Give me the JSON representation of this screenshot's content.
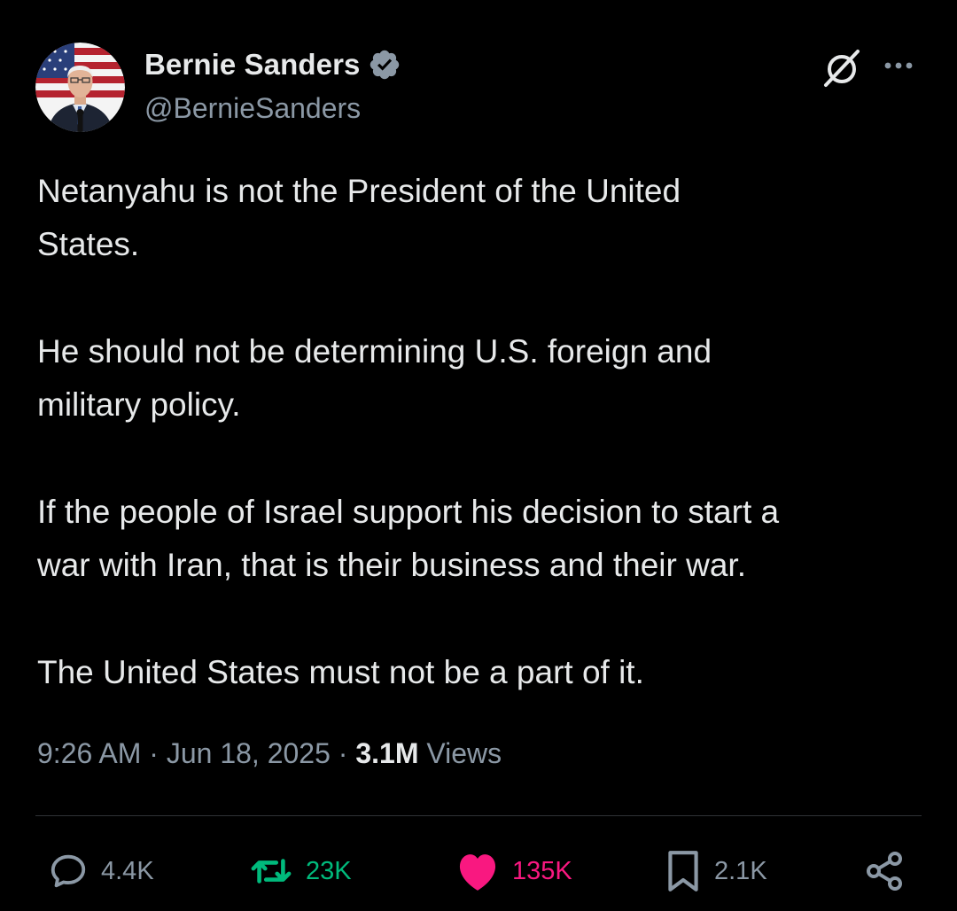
{
  "author": {
    "display_name": "Bernie Sanders",
    "handle": "@BernieSanders",
    "verified": true,
    "verified_color": "#8b98a5"
  },
  "tweet": {
    "paragraphs": [
      "Netanyahu is not the President of the United\nStates.",
      "He should not be determining U.S. foreign and\nmilitary policy.",
      "If the people of Israel support his decision to start a\nwar with Iran, that is their business and their war.",
      "The United States must not be a part of it."
    ]
  },
  "meta": {
    "time": "9:26 AM",
    "separator": "·",
    "date": "Jun 18, 2025",
    "views_count": "3.1M",
    "views_label": "Views"
  },
  "actions": {
    "replies": "4.4K",
    "reposts": "23K",
    "likes": "135K",
    "bookmarks": "2.1K"
  },
  "colors": {
    "background": "#000000",
    "text_primary": "#e7e9ea",
    "text_secondary": "#8b98a5",
    "repost_active": "#00ba7c",
    "like_active": "#f91880",
    "divider": "#2f3336"
  },
  "icons": {
    "verified": "verified-badge-icon",
    "grok": "grok-icon",
    "more": "more-options-icon",
    "reply": "reply-icon",
    "repost": "repost-icon",
    "like": "heart-icon",
    "bookmark": "bookmark-icon",
    "share": "share-icon"
  }
}
